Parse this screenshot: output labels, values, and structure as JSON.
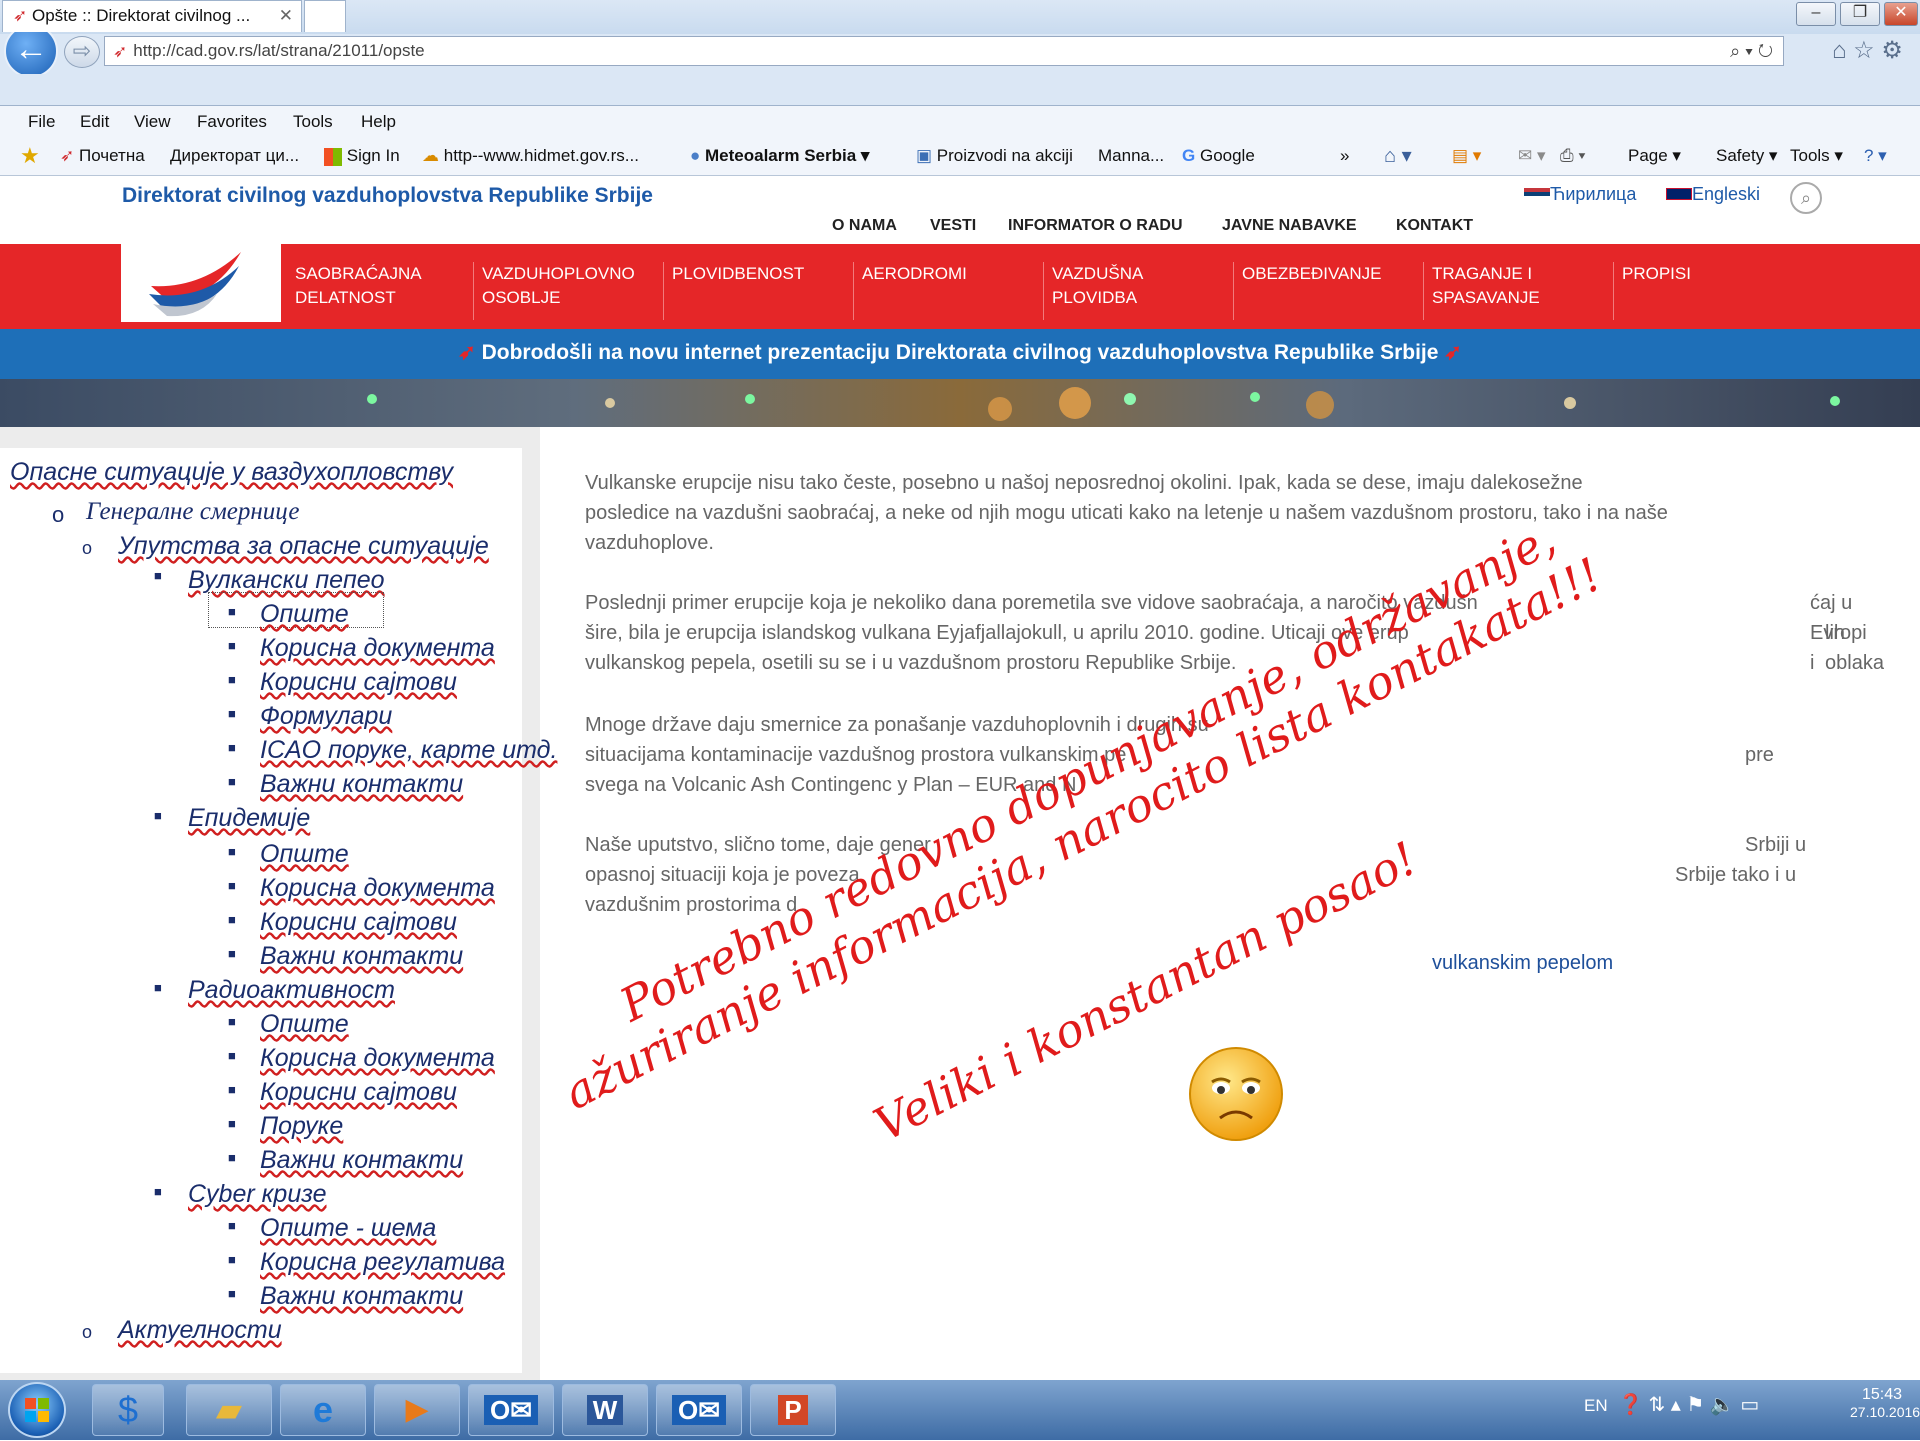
{
  "browser": {
    "url": "http://cad.gov.rs/lat/strana/21011/opste",
    "tab_title": "Opšte :: Direktorat civilnog ...",
    "menu": [
      "File",
      "Edit",
      "View",
      "Favorites",
      "Tools",
      "Help"
    ],
    "favorites": [
      "Почетна",
      "Директорат ци...",
      "Sign In",
      "http--www.hidmet.gov.rs...",
      "Meteoalarm Serbia",
      "Proizvodi na akciji",
      "Manna...",
      "Google"
    ],
    "toolbar": [
      "Page",
      "Safety",
      "Tools"
    ]
  },
  "site": {
    "title": "Direktorat civilnog vazduhoplovstva Republike Srbije",
    "lang": [
      "Ћирилица",
      "Engleski"
    ],
    "top_links": [
      "O NAMA",
      "VESTI",
      "INFORMATOR O RADU",
      "JAVNE NABAVKE",
      "KONTAKT"
    ],
    "nav": [
      [
        "SAOBRAĆAJNA",
        "DELATNOST"
      ],
      [
        "VAZDUHOPLOVNO",
        "OSOBLJE"
      ],
      [
        "PLOVIDBENOST",
        ""
      ],
      [
        "AERODROMI",
        ""
      ],
      [
        "VAZDUŠNA",
        "PLOVIDBA"
      ],
      [
        "OBEZBEĐIVANJE",
        ""
      ],
      [
        "TRAGANJE I",
        "SPASAVANJE"
      ],
      [
        "PROPISI",
        ""
      ]
    ],
    "welcome": "Dobrodošli na novu internet prezentaciju Direktorata civilnog vazduhoplovstva Republike Srbije"
  },
  "sidebar": {
    "root": "Опасне ситуације у ваздухопловству",
    "general": "Генералне смернице",
    "manual": "Упутства за опасне ситуације",
    "sections": [
      {
        "title": "Вулкански пепео",
        "items": [
          "Опште",
          "Корисна документа",
          "Корисни сајтови",
          "Формулари",
          "ICAO поруке, карте итд.",
          "Важни контакти"
        ]
      },
      {
        "title": "Епидемије",
        "items": [
          "Опште",
          "Корисна документа",
          "Корисни сајтови",
          "Важни контакти"
        ]
      },
      {
        "title": "Радиоактивност",
        "items": [
          "Опште",
          "Корисна документа",
          "Корисни сајтови",
          "Поруке",
          "Важни контакти"
        ]
      },
      {
        "title": "Cyber кризе",
        "items": [
          "Опште - шема",
          "Корисна регулатива",
          "Важни контакти"
        ]
      }
    ],
    "news": "Актуелности"
  },
  "main": {
    "p1": [
      "Vulkanske erupcije nisu tako česte, posebno u našoj neposrednoj okolini. Ipak, kada se dese, imaju dalekosežne",
      "posledice na vazdušni saobraćaj, a neke od njih mogu uticati kako na letenje u našem vazdušnom prostoru, tako i na naše",
      "vazduhoplove."
    ],
    "p2": [
      "Poslednji primer erupcije koja je nekoliko dana poremetila sve vidove saobraćaja, a naročito vazdušn",
      "ćaj u Evropi i",
      "šire, bila je erupcija islandskog vulkana Eyjafjallajokull, u aprilu 2010. godine. Uticaji ove erup",
      "lih oblaka",
      "vulkanskog pepela, osetili su se i u vazdušnom prostoru Republike Srbije."
    ],
    "p3": [
      "Mnoge države daju smernice za ponašanje vazduhoplovnih i drugih su",
      "situacijama kontaminacije vazdušnog prostora vulkanskim pe",
      "pre",
      "svega na Volcanic Ash Contingenc y Plan – EUR and N"
    ],
    "p4": [
      "Naše uputstvo, slično tome, daje gener",
      "Srbiji u",
      "opasnoj situaciji koja je poveza",
      "Srbije tako i u",
      "vazdušnim prostorima d"
    ],
    "link": "vulkanskim pepelom"
  },
  "annotation": {
    "line1": "Potrebno redovno dopunjavanje, održavanje,",
    "line2": "ažuriranje informacija, narocito  lista kontakata!!!",
    "line3": "Veliki i konstantan posao!"
  },
  "taskbar": {
    "lang": "EN",
    "time": "15:43",
    "date": "27.10.2016"
  },
  "colors": {
    "red": "#e52628",
    "blue": "#1e6fb8",
    "navy": "#1a2d6b",
    "annotation": "#e01b1b"
  }
}
